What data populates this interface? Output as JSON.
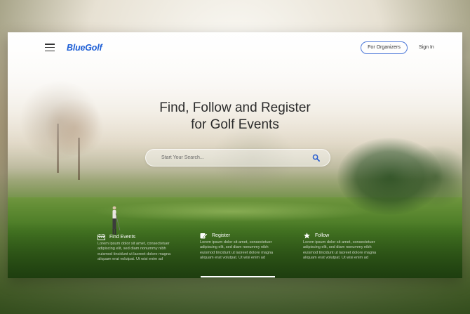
{
  "header": {
    "logo": "BlueGolf",
    "organizers_label": "For Organizers",
    "signin_label": "Sign In"
  },
  "hero": {
    "title_line1": "Find, Follow and Register",
    "title_line2": "for Golf Events"
  },
  "search": {
    "placeholder": "Start Your Search..."
  },
  "features": [
    {
      "title": "Find Events",
      "icon": "calendar-icon",
      "text": "Lorem ipsum dolor sit amet, consectetuer adipiscing elit, sed diam nonummy nibh euismod tincidunt ut laoreet dolore magna aliquam erat volutpat. Ut wisi enim ad"
    },
    {
      "title": "Register",
      "icon": "edit-icon",
      "text": "Lorem ipsum dolor sit amet, consectetuer adipiscing elit, sed diam nonummy nibh euismod tincidunt ut laoreet dolore magna aliquam erat volutpat. Ut wisi enim ad"
    },
    {
      "title": "Follow",
      "icon": "star-icon",
      "text": "Lorem ipsum dolor sit amet, consectetuer adipiscing elit, sed diam nonummy nibh euismod tincidunt ut laoreet dolore magna aliquam erat volutpat. Ut wisi enim ad"
    }
  ],
  "colors": {
    "brand": "#1e5fd6",
    "button_border": "#4d79d8"
  }
}
